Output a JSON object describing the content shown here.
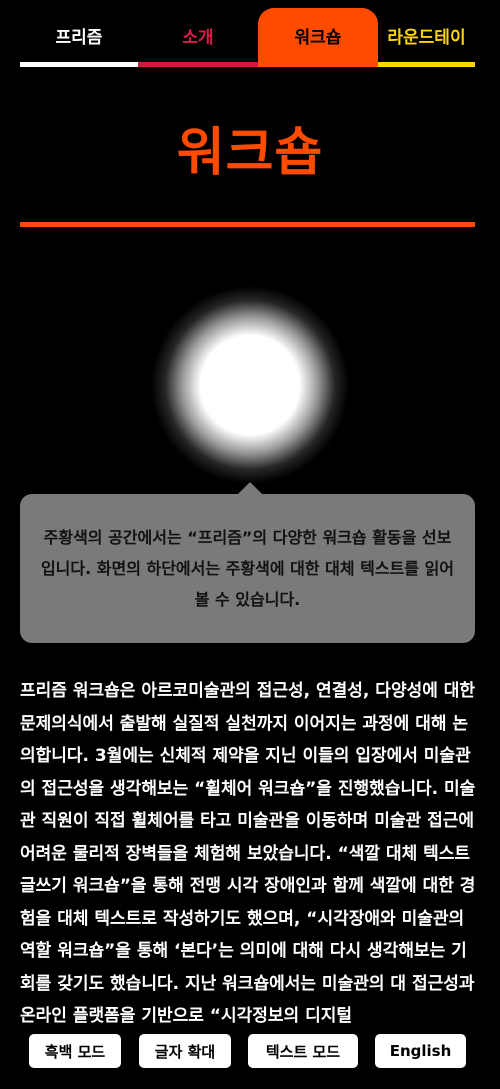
{
  "tabs": [
    {
      "label": "프리즘",
      "color": "#ffffff",
      "bar_color": "#ffffff"
    },
    {
      "label": "소개",
      "color": "#e01b4c",
      "bar_color": "#d4173f"
    },
    {
      "label": "워크숍",
      "color": "#000000",
      "bg": "#ff4b00",
      "bar_color": "#ff4b00",
      "active": true
    },
    {
      "label": "라운드테이",
      "color": "#ffd400",
      "bar_color": "#ffd400"
    }
  ],
  "page": {
    "title": "워크숍",
    "accent": "#ff4b00"
  },
  "tooltip": {
    "text": "주황색의 공간에서는 “프리즘”의 다양한 워크숍 활동을 선보입니다. 화면의 하단에서는 주황색에 대한 대체 텍스트를 읽어볼 수 있습니다."
  },
  "body": {
    "text": "프리즘 워크숍은 아르코미술관의 접근성, 연결성, 다양성에 대한 문제의식에서 출발해 실질적 실천까지 이어지는 과정에 대해 논의합니다. 3월에는 신체적 제약을 지닌 이들의 입장에서 미술관의 접근성을 생각해보는 “휠체어 워크숍”을 진행했습니다. 미술관 직원이 직접 휠체어를 타고 미술관을 이동하며 미술관 접근에 어려운 물리적 장벽들을 체험해 보았습니다. “색깔 대체 텍스트 글쓰기 워크숍”을 통해 전맹 시각 장애인과 함께 색깔에 대한 경험을 대체 텍스트로 작성하기도 했으며, “시각장애와 미술관의 역할 워크숍”을 통해 ‘본다’는 의미에 대해 다시 생각해보는 기회를 갖기도 했습니다. 지난 워크숍에서는 미술관의 대 접근성과 온라인 플랫폼을 기반으로 “시각정보의 디지털"
  },
  "buttons": {
    "mono": "흑백 모드",
    "zoom": "글자 확대",
    "text": "텍스트 모드",
    "english": "English"
  }
}
